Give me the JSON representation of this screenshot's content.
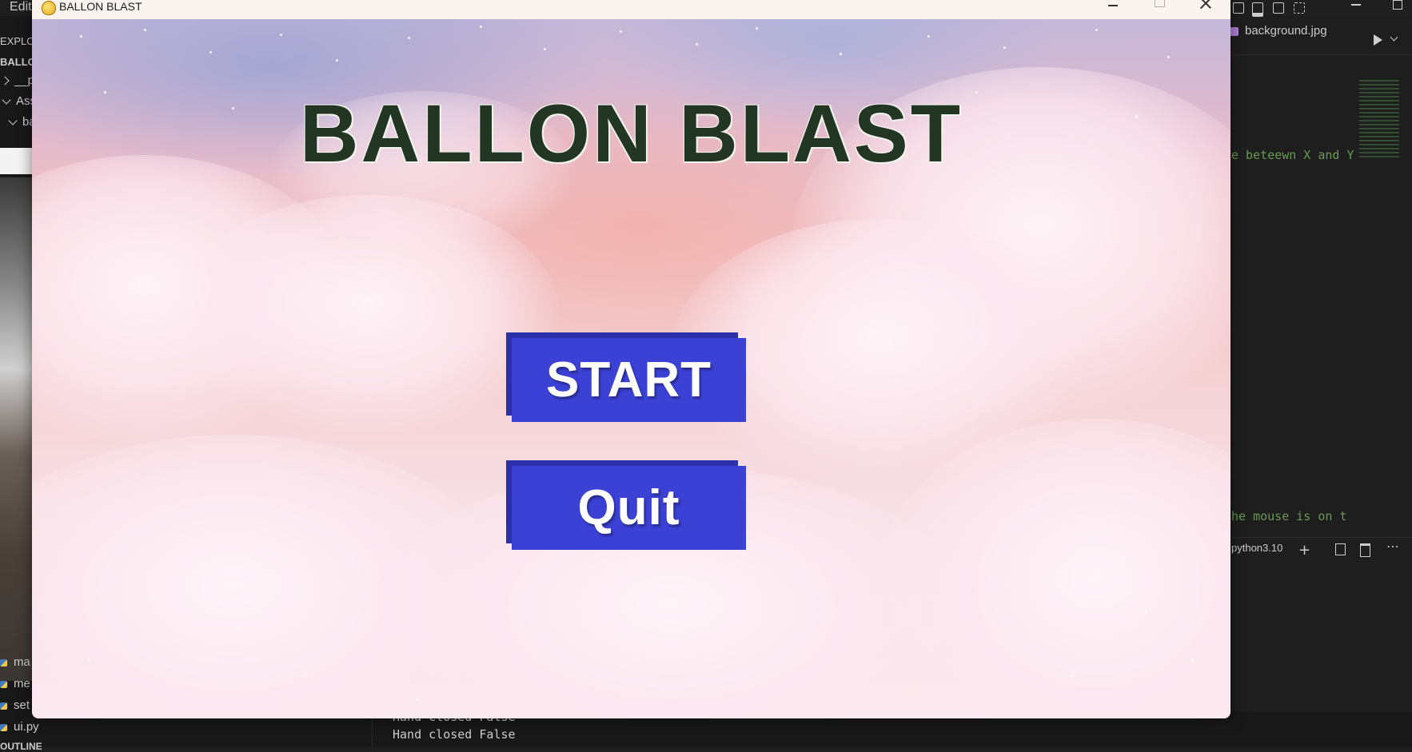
{
  "vscode": {
    "menu_edit": "Edit",
    "sidebar": {
      "explorer": "EXPLO",
      "project": "BALLO",
      "tree": [
        {
          "label": "__p",
          "state": "collapsed"
        },
        {
          "label": "Ass",
          "state": "expanded"
        },
        {
          "label": "ba",
          "state": "expanded"
        }
      ],
      "files": [
        "ma",
        "me",
        "set",
        "ui.py"
      ],
      "outline": "OUTLINE"
    },
    "editor": {
      "tab_label": "background.jpg",
      "code_comment_1": "e beteewn X and Y",
      "code_comment_2": "he mouse is on t"
    },
    "terminal": {
      "profile": "python3.10",
      "lines": [
        "Hand closed False",
        "Hand closed False"
      ]
    }
  },
  "game_window": {
    "title": "BALLON BLAST",
    "heading": "BALLON BLAST",
    "start_button": "START",
    "quit_button": "Quit",
    "colors": {
      "button": "#3a41d4",
      "heading": "#233523"
    }
  }
}
